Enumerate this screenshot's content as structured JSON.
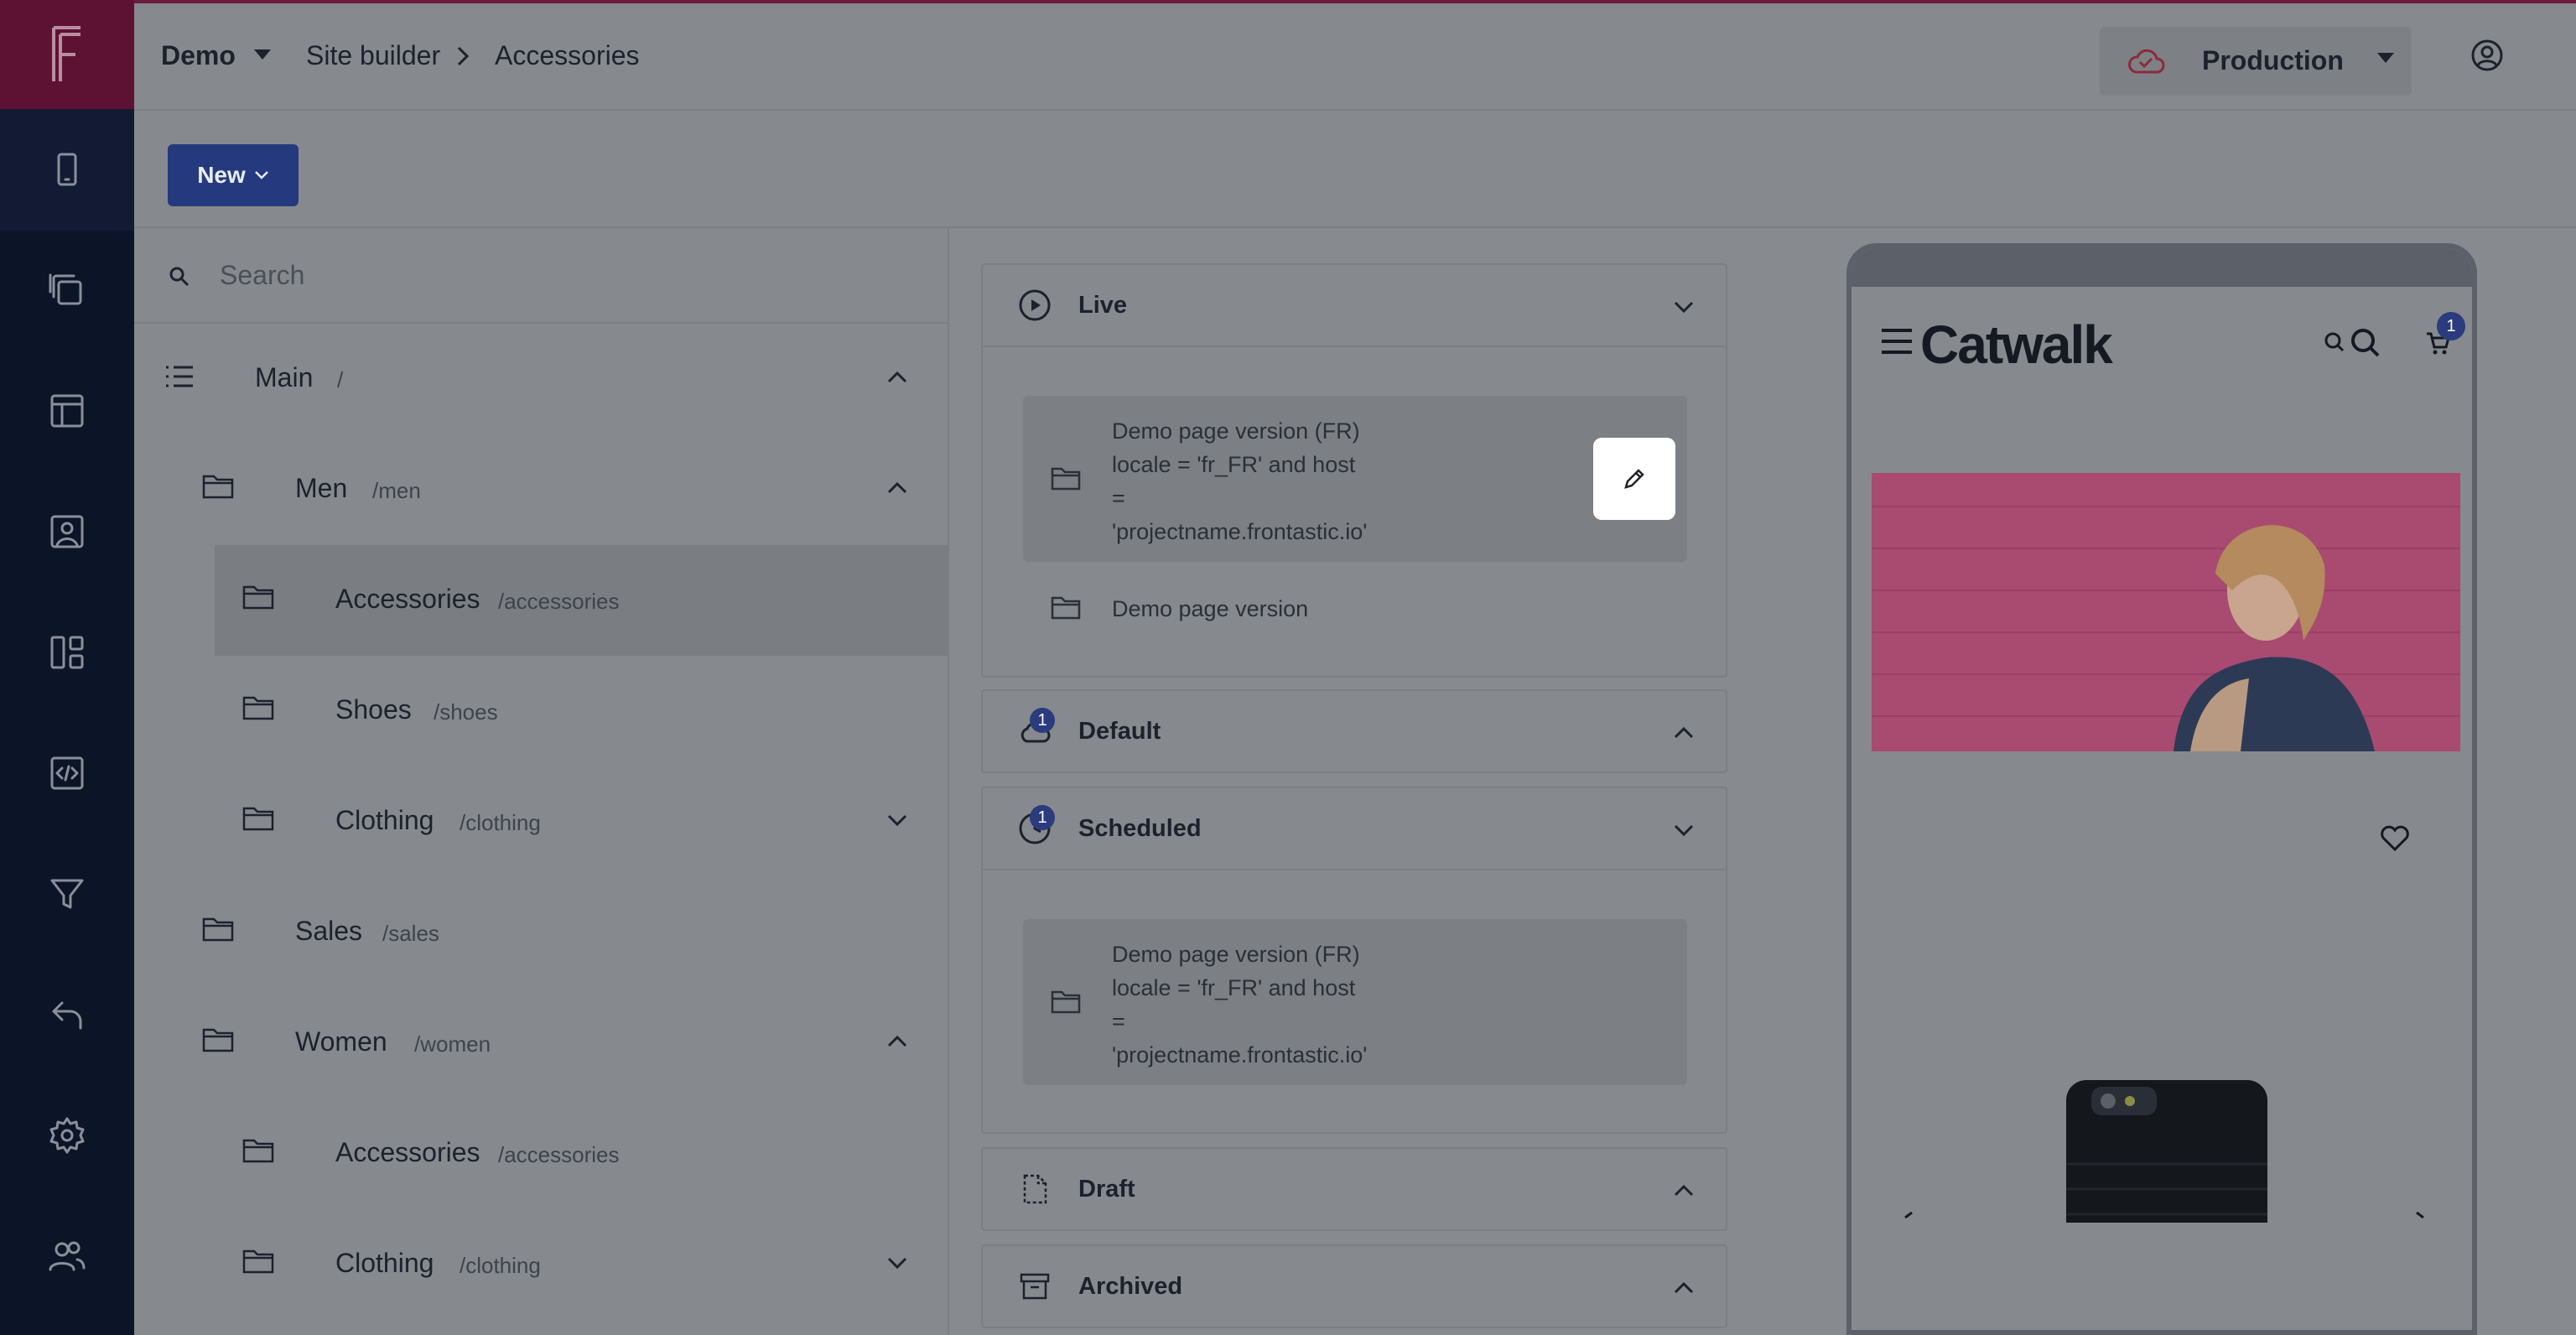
{
  "colors": {
    "rail": "#0c1428",
    "brand_accent": "#5e1233",
    "primary_button": "#253a7e",
    "badge": "#2a3b7e",
    "overlay": "#878a8f"
  },
  "header": {
    "project": "Demo",
    "breadcrumb": [
      "Site builder",
      "Accessories"
    ],
    "environment": "Production"
  },
  "toolbar": {
    "new_label": "New"
  },
  "tree": {
    "search_placeholder": "Search",
    "rows": [
      {
        "name": "Main",
        "path": "/",
        "expanded": true
      },
      {
        "name": "Men",
        "path": "/men",
        "expanded": true
      },
      {
        "name": "Accessories",
        "path": "/accessories",
        "selected": true
      },
      {
        "name": "Shoes",
        "path": "/shoes"
      },
      {
        "name": "Clothing",
        "path": "/clothing",
        "expanded": false
      },
      {
        "name": "Sales",
        "path": "/sales"
      },
      {
        "name": "Women",
        "path": "/women",
        "expanded": true
      },
      {
        "name": "Accessories",
        "path": "/accessories"
      },
      {
        "name": "Clothing",
        "path": "/clothing",
        "expanded": false
      }
    ]
  },
  "versions": {
    "live": {
      "title": "Live",
      "items": [
        {
          "text": "Demo page version (FR)\nlocale = 'fr_FR' and host\n=\n'projectname.frontastic.io'"
        },
        {
          "text": "Demo page version"
        }
      ]
    },
    "default": {
      "title": "Default",
      "badge": "1"
    },
    "scheduled": {
      "title": "Scheduled",
      "badge": "1",
      "items": [
        {
          "text": "Demo page version (FR)\nlocale = 'fr_FR' and host\n=\n'projectname.frontastic.io'"
        }
      ]
    },
    "draft": {
      "title": "Draft"
    },
    "archived": {
      "title": "Archived"
    }
  },
  "preview": {
    "brand": "Catwalk",
    "cart_count": "1"
  }
}
